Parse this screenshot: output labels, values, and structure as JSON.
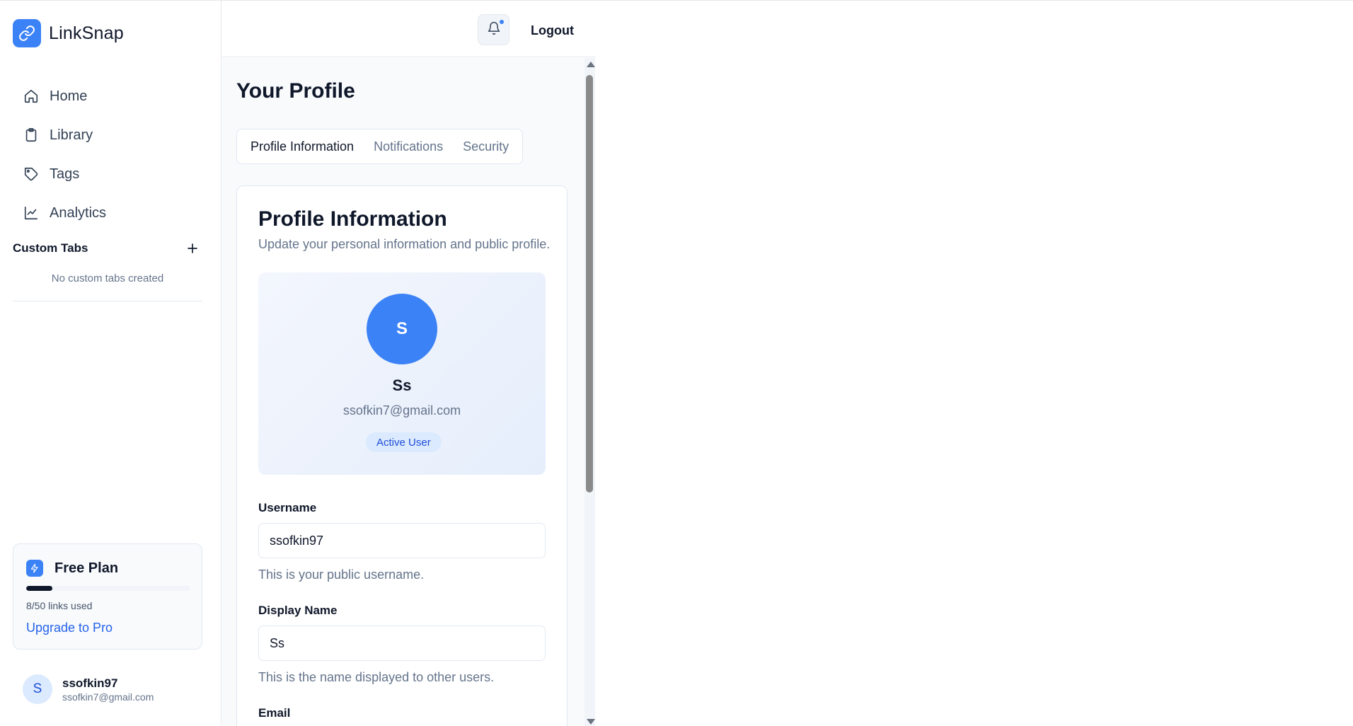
{
  "brand": {
    "name": "LinkSnap",
    "logo_icon": "link-icon",
    "accent": "#3b82f6"
  },
  "sidebar": {
    "items": [
      {
        "label": "Home",
        "icon": "home-icon"
      },
      {
        "label": "Library",
        "icon": "clipboard-icon"
      },
      {
        "label": "Tags",
        "icon": "tag-icon"
      },
      {
        "label": "Analytics",
        "icon": "line-chart-icon"
      }
    ],
    "custom_tabs": {
      "title": "Custom Tabs",
      "empty_text": "No custom tabs created",
      "add_icon": "plus-icon"
    },
    "plan": {
      "title": "Free Plan",
      "icon": "lightning-icon",
      "usage_text": "8/50 links used",
      "used": 8,
      "limit": 50,
      "upgrade_label": "Upgrade to Pro"
    },
    "user": {
      "initial": "S",
      "username": "ssofkin97",
      "email": "ssofkin7@gmail.com"
    }
  },
  "header": {
    "bell_icon": "bell-icon",
    "has_unread": true,
    "logout_label": "Logout"
  },
  "main": {
    "page_title": "Your Profile",
    "tabs": [
      {
        "label": "Profile Information",
        "active": true
      },
      {
        "label": "Notifications",
        "active": false
      },
      {
        "label": "Security",
        "active": false
      }
    ],
    "card": {
      "title": "Profile Information",
      "subtitle": "Update your personal information and public profile.",
      "profile": {
        "initial": "S",
        "display_name": "Ss",
        "email": "ssofkin7@gmail.com",
        "badge": "Active User"
      },
      "fields": {
        "username": {
          "label": "Username",
          "value": "ssofkin97",
          "help": "This is your public username."
        },
        "display_name": {
          "label": "Display Name",
          "value": "Ss",
          "help": "This is the name displayed to other users."
        },
        "email": {
          "label": "Email"
        }
      }
    }
  }
}
